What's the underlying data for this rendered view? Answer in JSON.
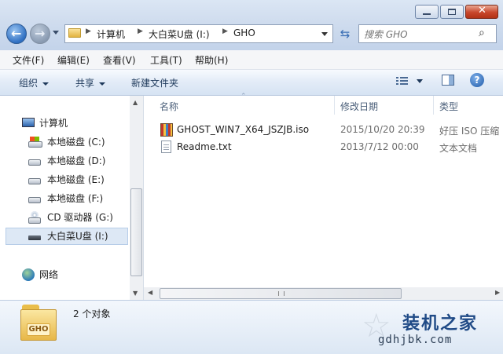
{
  "window": {
    "back_label": "Back",
    "forward_label": "Forward"
  },
  "address": {
    "parts": [
      "计算机",
      "大白菜U盘 (I:)",
      "GHO"
    ]
  },
  "search": {
    "placeholder": "搜索 GHO"
  },
  "menu": {
    "items": [
      "文件(F)",
      "编辑(E)",
      "查看(V)",
      "工具(T)",
      "帮助(H)"
    ]
  },
  "toolbar": {
    "organize": "组织",
    "share": "共享",
    "new_folder": "新建文件夹"
  },
  "nav": {
    "computer": "计算机",
    "drives": [
      "本地磁盘 (C:)",
      "本地磁盘 (D:)",
      "本地磁盘 (E:)",
      "本地磁盘 (F:)",
      "CD 驱动器 (G:)",
      "大白菜U盘 (I:)"
    ],
    "network": "网络"
  },
  "columns": {
    "name": "名称",
    "modified": "修改日期",
    "type": "类型"
  },
  "files": [
    {
      "name": "GHOST_WIN7_X64_JSZJB.iso",
      "modified": "2015/10/20 20:39",
      "type": "好压 ISO 压缩"
    },
    {
      "name": "Readme.txt",
      "modified": "2013/7/12 00:00",
      "type": "文本文档"
    }
  ],
  "details": {
    "count": "2 个对象",
    "folder_icon_label": "GHO"
  },
  "watermark": {
    "brand": "装机之家",
    "url": "gdhjbk.com"
  }
}
